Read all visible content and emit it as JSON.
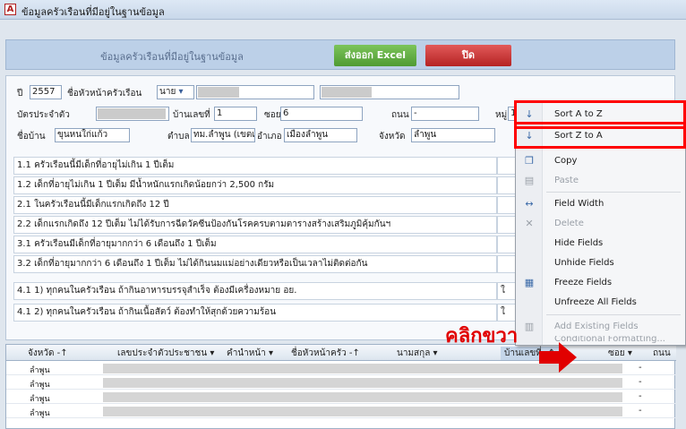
{
  "window": {
    "app_icon": "A",
    "title": "ข้อมูลครัวเรือนที่มีอยู่ในฐานข้อมูล"
  },
  "banner": {
    "title": "ข้อมูลครัวเรือนที่มีอยู่ในฐานข้อมูล",
    "excel_button": "ส่งออก Excel",
    "close_button": "ปิด"
  },
  "form": {
    "year_label": "ปี",
    "year_value": "2557",
    "head_label": "ชื่อหัวหน้าครัวเรือน",
    "prefix_value": "นาย",
    "id_label": "บัตรประจำตัว",
    "house_no_label": "บ้านเลขที่",
    "house_no_value": "1",
    "soi_label": "ซอย",
    "soi_value": "6",
    "road_label": "ถนน",
    "road_value": "-",
    "moo_label": "หมู่",
    "moo_value": "1",
    "village_label": "ชื่อบ้าน",
    "village_value": "ขุนหนใก่แก้ว",
    "tambon_label": "ตำบล",
    "tambon_value": "ทม.ลำพูน (เขตเมื",
    "amphoe_label": "อำเภอ",
    "amphoe_value": "เมืองลำพูน",
    "province_label": "จังหวัด",
    "province_value": "ลำพูน"
  },
  "questions": [
    {
      "text": "1.1 ครัวเรือนนี้มีเด็กที่อายุไม่เกิน 1 ปีเต็ม",
      "answer": ""
    },
    {
      "text": "1.2 เด็กที่อายุไม่เกิน 1 ปีเต็ม มีน้ำหนักแรกเกิดน้อยกว่า 2,500 กรัม",
      "answer": ""
    },
    {
      "text": "2.1 ในครัวเรือนนี้มีเด็กแรกเกิดถึง 12 ปี",
      "answer": ""
    },
    {
      "text": "2.2 เด็กแรกเกิดถึง 12 ปีเต็ม ไม่ได้รับการฉีดวัคซีนป้องกันโรคครบตามตารางสร้างเสริมภูมิคุ้มกันฯ",
      "answer": ""
    },
    {
      "text": "3.1 ครัวเรือนมีเด็กที่อายุมากกว่า 6 เดือนถึง 1 ปีเต็ม",
      "answer": ""
    },
    {
      "text": "3.2 เด็กที่อายุมากกว่า 6 เดือนถึง 1 ปีเต็ม ไม่ได้กินนมแม่อย่างเดียวหรือเป็นเวลาไม่ติดต่อกัน",
      "answer": ""
    },
    {
      "text": "4.1 1) ทุกคนในครัวเรือน ถ้ากินอาหารบรรจุสำเร็จ ต้องมีเครื่องหมาย อย.",
      "answer": "ใ"
    },
    {
      "text": "4.1 2) ทุกคนในครัวเรือน ถ้ากินเนื้อสัตว์ ต้องทำให้สุกด้วยความร้อน",
      "answer": "ใ"
    }
  ],
  "grid": {
    "columns": [
      "จังหวัด",
      "เลขประจำตัวประชาชน",
      "คำนำหน้า",
      "ชื่อหัวหน้าครัว",
      "นามสกุล",
      "บ้านเลขที่",
      "ซอย",
      "ถนน"
    ],
    "rows": [
      {
        "province": "ลำพูน",
        "road": "-"
      },
      {
        "province": "ลำพูน",
        "road": "-"
      },
      {
        "province": "ลำพูน",
        "road": "-"
      },
      {
        "province": "ลำพูน",
        "road": "-"
      }
    ]
  },
  "context_menu": {
    "items": [
      {
        "label": "Sort A to Z",
        "icon": "sort-ascending-icon",
        "disabled": false
      },
      {
        "label": "Sort Z to A",
        "icon": "sort-descending-icon",
        "disabled": false
      },
      {
        "label": "Copy",
        "icon": "copy-icon",
        "disabled": false
      },
      {
        "label": "Paste",
        "icon": "paste-icon",
        "disabled": true
      },
      {
        "label": "Field Width",
        "icon": "field-width-icon",
        "disabled": false
      },
      {
        "label": "Delete",
        "icon": "delete-icon",
        "disabled": true
      },
      {
        "label": "Hide Fields",
        "icon": "",
        "disabled": false
      },
      {
        "label": "Unhide Fields",
        "icon": "",
        "disabled": false
      },
      {
        "label": "Freeze Fields",
        "icon": "freeze-icon",
        "disabled": false
      },
      {
        "label": "Unfreeze All Fields",
        "icon": "",
        "disabled": false
      },
      {
        "label": "Add Existing Fields",
        "icon": "add-fields-icon",
        "disabled": true
      },
      {
        "label": "Conditional Formatting...",
        "icon": "conditional-format-icon",
        "disabled": true
      }
    ]
  },
  "annotation": {
    "text": "คลิกขวา",
    "color": "#e10000"
  },
  "colors": {
    "excel_button": "#5aa83a",
    "close_button": "#c83030",
    "highlight": "#ff0000"
  }
}
